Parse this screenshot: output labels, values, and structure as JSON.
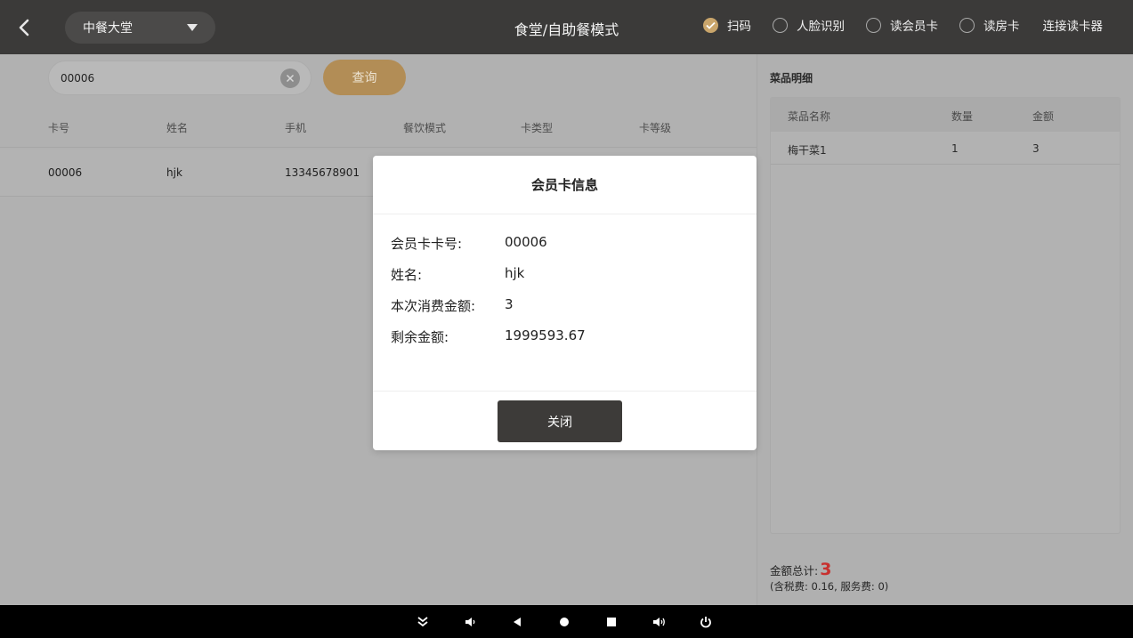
{
  "header": {
    "hall": "中餐大堂",
    "title": "食堂/自助餐模式",
    "modes": [
      {
        "label": "扫码",
        "checked": true
      },
      {
        "label": "人脸识别",
        "checked": false
      },
      {
        "label": "读会员卡",
        "checked": false
      },
      {
        "label": "读房卡",
        "checked": false
      }
    ],
    "connect_label": "连接读卡器"
  },
  "search": {
    "value": "00006",
    "query_label": "查询"
  },
  "member_table": {
    "columns": [
      "卡号",
      "姓名",
      "手机",
      "餐饮模式",
      "卡类型",
      "卡等级"
    ],
    "rows": [
      {
        "card_no": "00006",
        "name": "hjk",
        "phone": "13345678901"
      }
    ]
  },
  "dish_panel": {
    "title": "菜品明细",
    "columns": [
      "菜品名称",
      "数量",
      "金额"
    ],
    "rows": [
      {
        "name": "梅干菜1",
        "qty": "1",
        "amount": "3"
      }
    ],
    "total_label": "金额总计:",
    "total_value": "3",
    "tax_note": "(含税费: 0.16, 服务费: 0)"
  },
  "modal": {
    "title": "会员卡信息",
    "fields": [
      {
        "label": "会员卡卡号:",
        "value": "00006"
      },
      {
        "label": "姓名:",
        "value": "hjk"
      },
      {
        "label": "本次消费金额:",
        "value": "3"
      },
      {
        "label": "剩余金额:",
        "value": "1999593.67"
      }
    ],
    "close_label": "关闭"
  },
  "colors": {
    "header_bg": "#3b3a39",
    "accent_gold": "#c9a56b",
    "query_button": "#b28d56",
    "total_red": "#c8302e",
    "close_button": "#3d3b39"
  },
  "nav_icons": [
    "collapse-icon",
    "volume-down-icon",
    "back-icon",
    "home-icon",
    "recents-icon",
    "volume-up-icon",
    "power-icon"
  ]
}
